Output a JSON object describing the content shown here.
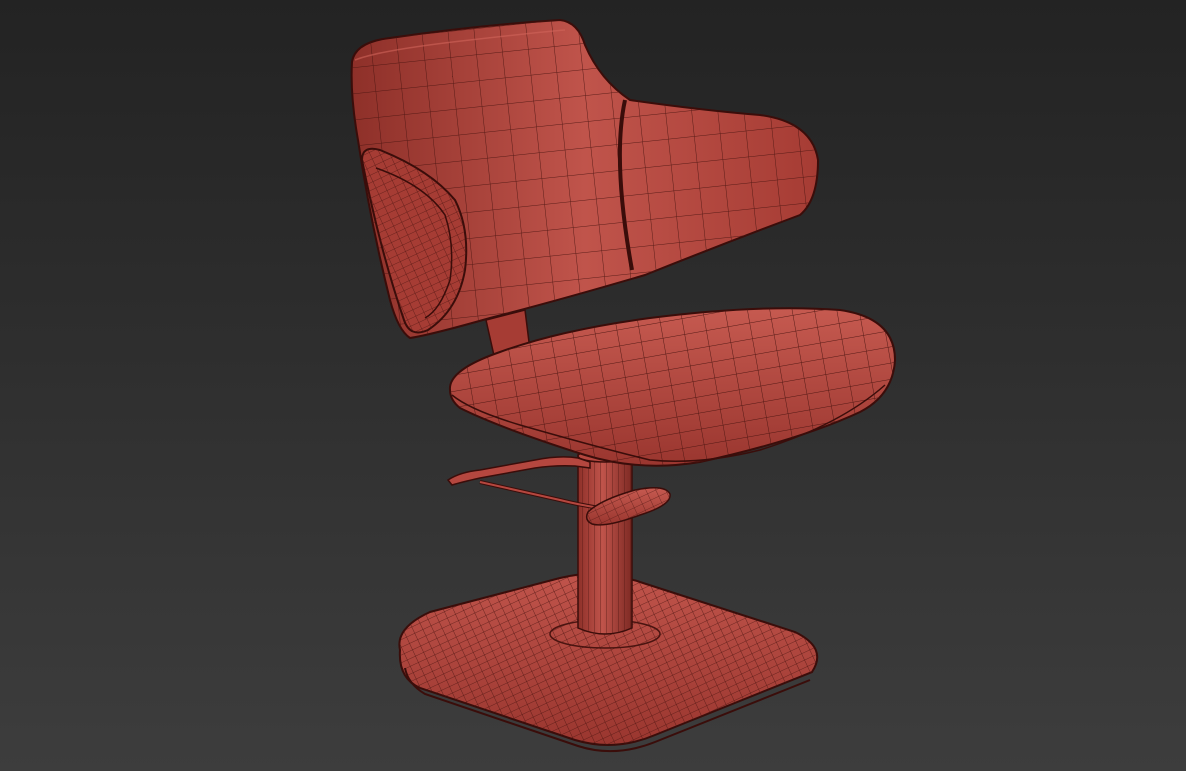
{
  "scene": {
    "subject": "chair-3d-wireframe",
    "colors": {
      "background_top": "#232323",
      "background_bottom": "#3d3d3d",
      "mesh_fill": "#b5473f",
      "mesh_fill_highlight": "#d0645a",
      "mesh_fill_shadow": "#8e3029",
      "wire": "#4a1410",
      "dark_gap": "#3a0d0a"
    }
  }
}
